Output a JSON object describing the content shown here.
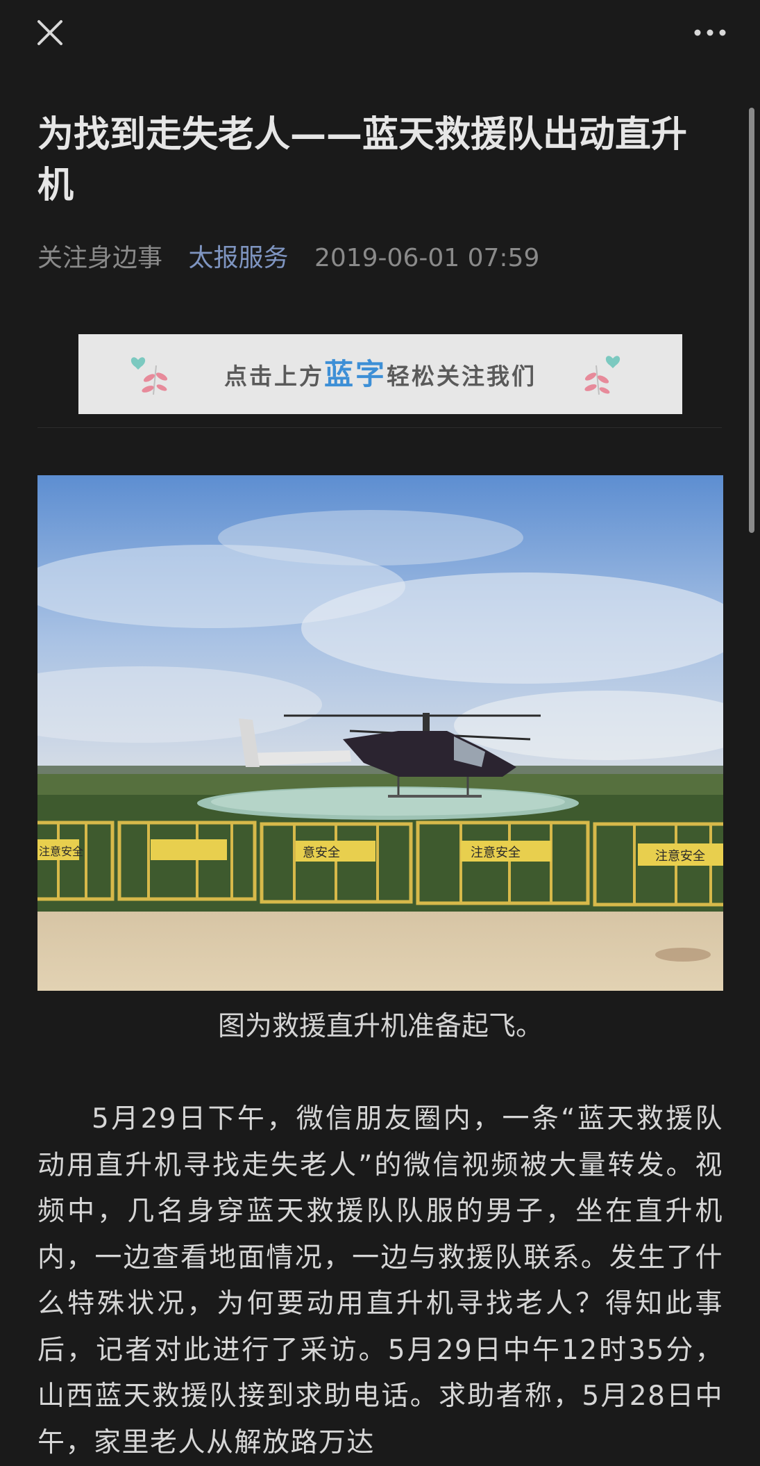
{
  "article": {
    "title": "为找到走失老人——蓝天救援队出动直升机",
    "author": "关注身边事",
    "account": "太报服务",
    "date": "2019-06-01 07:59"
  },
  "banner": {
    "prefix": "点击上方",
    "highlight": "蓝字",
    "suffix": "轻松关注我们",
    "highlight_color": "#3d8fd6"
  },
  "figure": {
    "signs": [
      "意安全",
      "注意安全",
      "注意安全",
      "注意安全"
    ],
    "caption": "图为救援直升机准备起飞。"
  },
  "paragraphs": [
    "5月29日下午，微信朋友圈内，一条“蓝天救援队动用直升机寻找走失老人”的微信视频被大量转发。视频中，几名身穿蓝天救援队队服的男子，坐在直升机内，一边查看地面情况，一边与救援队联系。发生了什么特殊状况，为何要动用直升机寻找老人？得知此事后，记者对此进行了采访。5月29日中午12时35分，山西蓝天救援队接到求助电话。求助者称，5月28日中午，家里老人从解放路万达"
  ],
  "icons": {
    "close": "close-icon",
    "more": "more-dots-icon"
  },
  "colors": {
    "background": "#1a1a1a",
    "link": "#7f95c1",
    "meta": "#8a8a8a"
  }
}
